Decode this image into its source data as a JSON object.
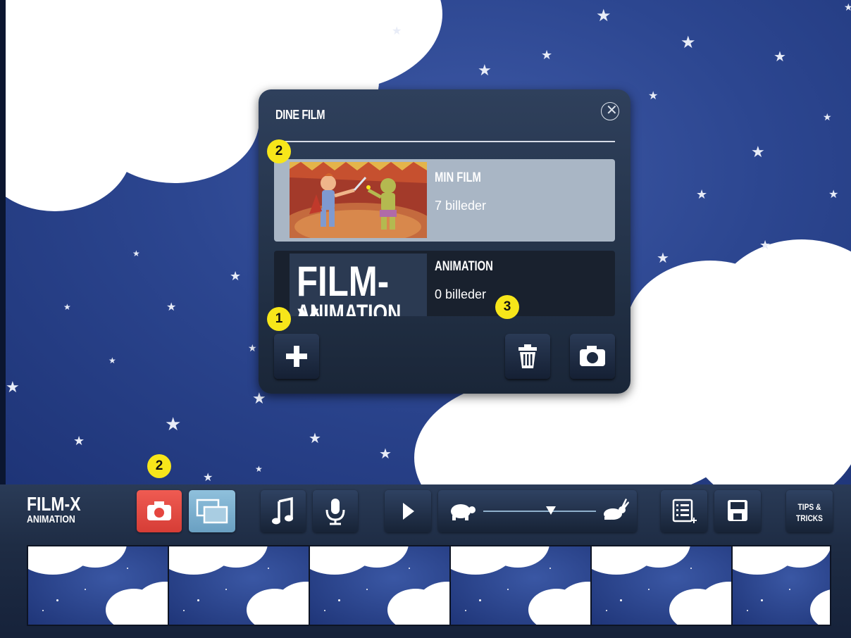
{
  "dialog": {
    "title": "DINE FILM",
    "films": [
      {
        "name": "MIN FILM",
        "count": "7 billeder",
        "selected": true
      },
      {
        "name": "ANIMATION",
        "count": "0 billeder",
        "selected": false
      }
    ],
    "thumb_logo": {
      "line1": "FILM-X",
      "line2": "ANIMATION"
    }
  },
  "markers": {
    "m1": "1",
    "m2_top": "2",
    "m2_bottom": "2",
    "m3": "3"
  },
  "toolbar": {
    "logo_line1": "FILM-X",
    "logo_line2": "ANIMATION",
    "tips_line1": "TIPS &",
    "tips_line2": "TRICKS",
    "speed_level": 0.6
  },
  "colors": {
    "marker": "#f7e61a",
    "camera_active": "#e5463f",
    "onion_active": "#7fb0cf"
  }
}
